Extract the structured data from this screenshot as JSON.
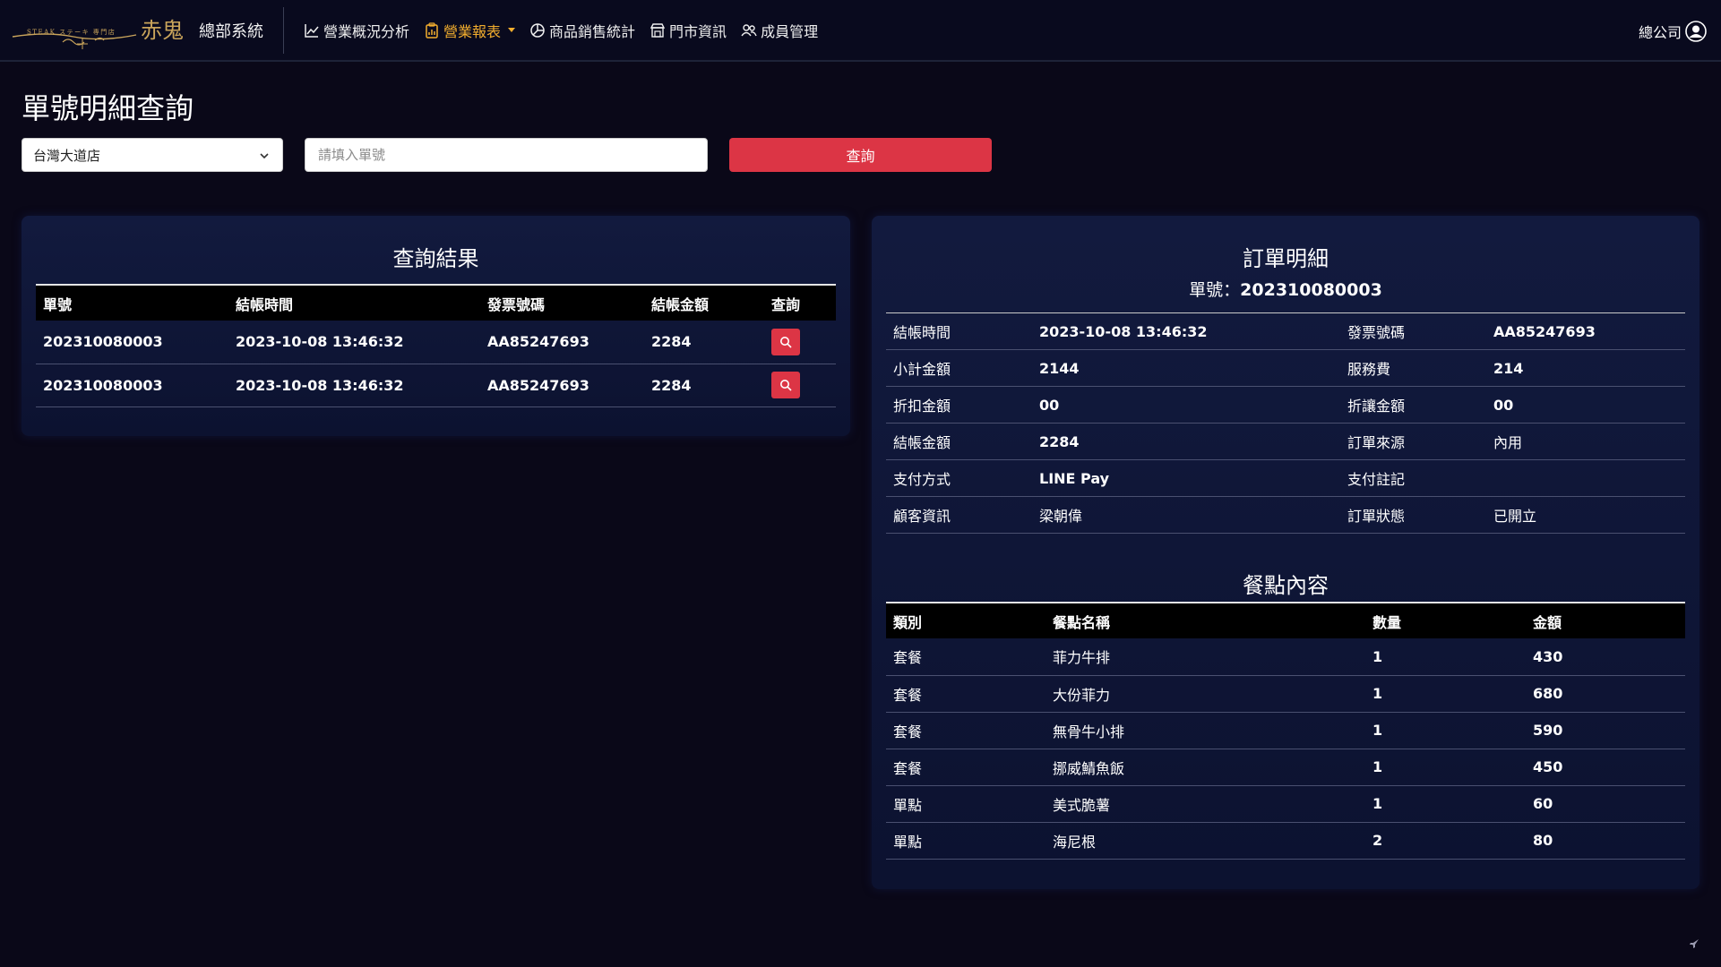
{
  "header": {
    "logo_text": "STEAK ステーキ 専門店 赤鬼",
    "brand_title": "總部系統",
    "nav": [
      {
        "label": "營業概況分析",
        "icon": "line-chart-icon",
        "active": false
      },
      {
        "label": "營業報表",
        "icon": "clipboard-icon",
        "active": true
      },
      {
        "label": "商品銷售統計",
        "icon": "pie-chart-icon",
        "active": false
      },
      {
        "label": "門市資訊",
        "icon": "store-icon",
        "active": false
      },
      {
        "label": "成員管理",
        "icon": "users-icon",
        "active": false
      }
    ],
    "user_label": "總公司",
    "user_icon": "user-circle-icon"
  },
  "page": {
    "title": "單號明細查詢",
    "store_select_value": "台灣大道店",
    "order_input_placeholder": "請填入單號",
    "query_button": "查詢"
  },
  "result": {
    "title": "查詢結果",
    "columns": [
      "單號",
      "結帳時間",
      "發票號碼",
      "結帳金額",
      "查詢"
    ],
    "rows": [
      {
        "order_no": "202310080003",
        "checkout_time": "2023-10-08 13:46:32",
        "invoice": "AA85247693",
        "amount": "2284"
      },
      {
        "order_no": "202310080003",
        "checkout_time": "2023-10-08 13:46:32",
        "invoice": "AA85247693",
        "amount": "2284"
      }
    ]
  },
  "detail": {
    "title": "訂單明細",
    "order_label": "單號：",
    "order_no": "202310080003",
    "rows": [
      {
        "l1": "結帳時間",
        "v1": "2023-10-08 13:46:32",
        "l2": "發票號碼",
        "v2": "AA85247693"
      },
      {
        "l1": "小計金額",
        "v1": "2144",
        "l2": "服務費",
        "v2": "214"
      },
      {
        "l1": "折扣金額",
        "v1": "00",
        "l2": "折讓金額",
        "v2": "00"
      },
      {
        "l1": "結帳金額",
        "v1": "2284",
        "l2": "訂單來源",
        "v2": "內用"
      },
      {
        "l1": "支付方式",
        "v1": "LINE Pay",
        "l2": "支付註記",
        "v2": ""
      },
      {
        "l1": "顧客資訊",
        "v1": "梁朝偉",
        "l2": "訂單狀態",
        "v2": "已開立"
      }
    ]
  },
  "items": {
    "title": "餐點內容",
    "columns": [
      "類別",
      "餐點名稱",
      "數量",
      "金額"
    ],
    "rows": [
      {
        "category": "套餐",
        "name": "菲力牛排",
        "qty": "1",
        "amount": "430"
      },
      {
        "category": "套餐",
        "name": "大份菲力",
        "qty": "1",
        "amount": "680"
      },
      {
        "category": "套餐",
        "name": "無骨牛小排",
        "qty": "1",
        "amount": "590"
      },
      {
        "category": "套餐",
        "name": "挪威鯖魚飯",
        "qty": "1",
        "amount": "450"
      },
      {
        "category": "單點",
        "name": "美式脆薯",
        "qty": "1",
        "amount": "60"
      },
      {
        "category": "單點",
        "name": "海尼根",
        "qty": "2",
        "amount": "80"
      }
    ]
  },
  "colors": {
    "accent_active": "#f3ae2e",
    "danger": "#dc3545",
    "background": "#0a0818",
    "card": "#121a3e"
  }
}
